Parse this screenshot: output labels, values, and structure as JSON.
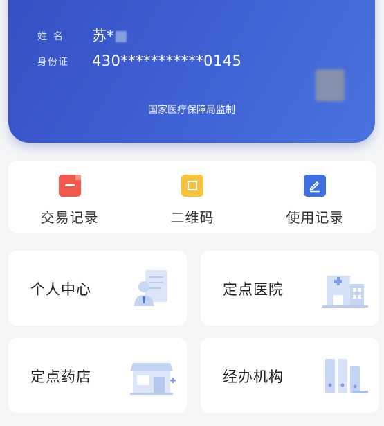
{
  "card": {
    "name_label": "姓名",
    "name_value": "苏*",
    "id_label": "身份证",
    "id_value": "430***********0145",
    "supervised_by": "国家医疗保障局监制"
  },
  "actions": [
    {
      "label": "交易记录",
      "icon": "document-icon",
      "color": "#ef5a4c"
    },
    {
      "label": "二维码",
      "icon": "qr-code-icon",
      "color": "#f7c33c"
    },
    {
      "label": "使用记录",
      "icon": "edit-icon",
      "color": "#3f6fe0"
    }
  ],
  "tiles": [
    {
      "label": "个人中心",
      "icon": "personal-center-icon"
    },
    {
      "label": "定点医院",
      "icon": "hospital-icon"
    },
    {
      "label": "定点药店",
      "icon": "pharmacy-icon"
    },
    {
      "label": "经办机构",
      "icon": "agency-icon"
    }
  ]
}
